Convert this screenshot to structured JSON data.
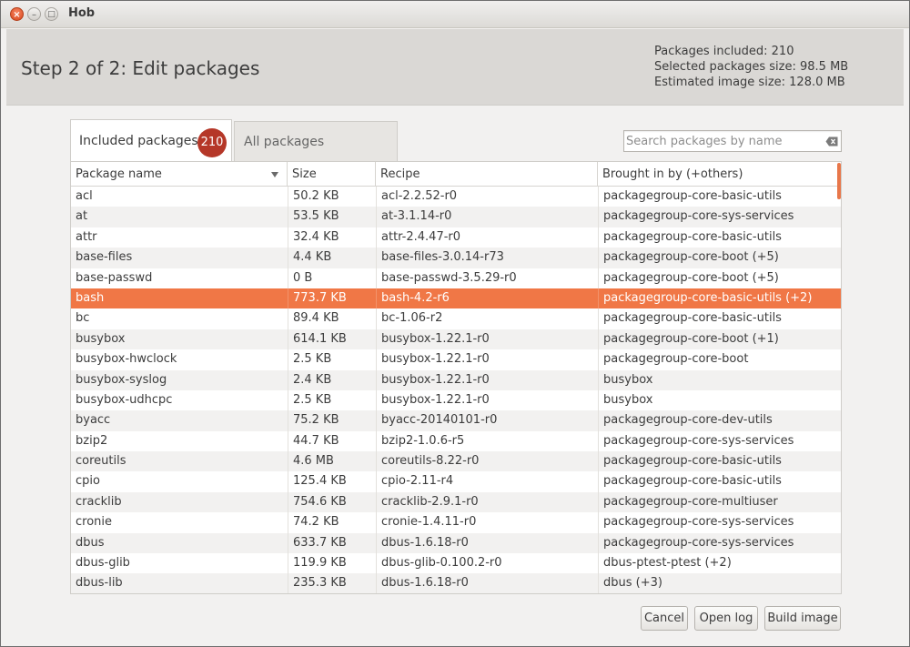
{
  "window": {
    "title": "Hob",
    "close_glyph": "×",
    "minimize_glyph": "–",
    "maximize_glyph": "□"
  },
  "header": {
    "step_title": "Step 2 of 2: Edit packages",
    "packages_included": "Packages included: 210",
    "selected_size": "Selected packages size: 98.5 MB",
    "image_size": "Estimated image size: 128.0 MB"
  },
  "tabs": [
    {
      "label": "Included packages",
      "badge": "210",
      "active": true
    },
    {
      "label": "All packages",
      "active": false
    }
  ],
  "search": {
    "placeholder": "Search packages by name",
    "value": "",
    "clear_icon": "backspace-clear-icon"
  },
  "table": {
    "columns": [
      "Package name",
      "Size",
      "Recipe",
      "Brought in by (+others)"
    ],
    "sort_column": "Package name",
    "selected_row": "bash",
    "rows": [
      [
        "acl",
        "50.2 KB",
        "acl-2.2.52-r0",
        "packagegroup-core-basic-utils"
      ],
      [
        "at",
        "53.5 KB",
        "at-3.1.14-r0",
        "packagegroup-core-sys-services"
      ],
      [
        "attr",
        "32.4 KB",
        "attr-2.4.47-r0",
        "packagegroup-core-basic-utils"
      ],
      [
        "base-files",
        "4.4 KB",
        "base-files-3.0.14-r73",
        "packagegroup-core-boot (+5)"
      ],
      [
        "base-passwd",
        "0 B",
        "base-passwd-3.5.29-r0",
        "packagegroup-core-boot (+5)"
      ],
      [
        "bash",
        "773.7 KB",
        "bash-4.2-r6",
        "packagegroup-core-basic-utils (+2)"
      ],
      [
        "bc",
        "89.4 KB",
        "bc-1.06-r2",
        "packagegroup-core-basic-utils"
      ],
      [
        "busybox",
        "614.1 KB",
        "busybox-1.22.1-r0",
        "packagegroup-core-boot (+1)"
      ],
      [
        "busybox-hwclock",
        "2.5 KB",
        "busybox-1.22.1-r0",
        "packagegroup-core-boot"
      ],
      [
        "busybox-syslog",
        "2.4 KB",
        "busybox-1.22.1-r0",
        "busybox"
      ],
      [
        "busybox-udhcpc",
        "2.5 KB",
        "busybox-1.22.1-r0",
        "busybox"
      ],
      [
        "byacc",
        "75.2 KB",
        "byacc-20140101-r0",
        "packagegroup-core-dev-utils"
      ],
      [
        "bzip2",
        "44.7 KB",
        "bzip2-1.0.6-r5",
        "packagegroup-core-sys-services"
      ],
      [
        "coreutils",
        "4.6 MB",
        "coreutils-8.22-r0",
        "packagegroup-core-basic-utils"
      ],
      [
        "cpio",
        "125.4 KB",
        "cpio-2.11-r4",
        "packagegroup-core-basic-utils"
      ],
      [
        "cracklib",
        "754.6 KB",
        "cracklib-2.9.1-r0",
        "packagegroup-core-multiuser"
      ],
      [
        "cronie",
        "74.2 KB",
        "cronie-1.4.11-r0",
        "packagegroup-core-sys-services"
      ],
      [
        "dbus",
        "633.7 KB",
        "dbus-1.6.18-r0",
        "packagegroup-core-sys-services"
      ],
      [
        "dbus-glib",
        "119.9 KB",
        "dbus-glib-0.100.2-r0",
        "dbus-ptest-ptest (+2)"
      ],
      [
        "dbus-lib",
        "235.3 KB",
        "dbus-1.6.18-r0",
        "dbus (+3)"
      ]
    ]
  },
  "buttons": {
    "cancel": "Cancel",
    "open_log": "Open log",
    "build_image": "Build image"
  },
  "colors": {
    "selection": "#f07746",
    "badge": "#b53728",
    "header_band": "#dad8d5"
  }
}
